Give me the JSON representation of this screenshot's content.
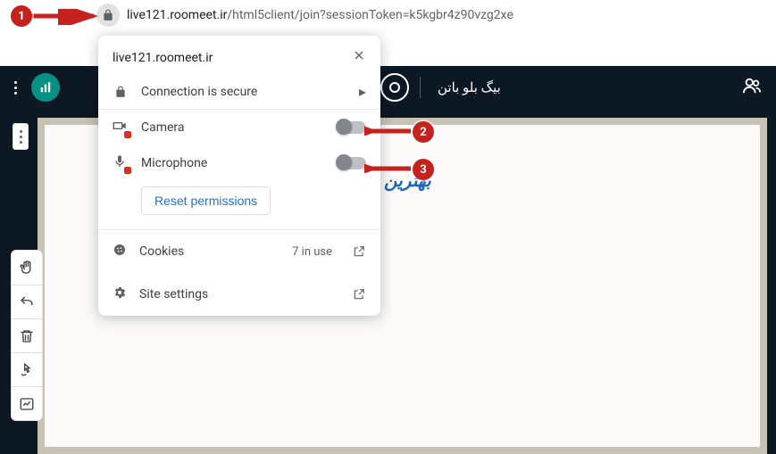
{
  "address_bar": {
    "url_host": "live121.roomeet.ir",
    "url_path": "/html5client/join?sessionToken=k5kgbr4z90vzg2xe"
  },
  "app_header": {
    "room_name": "بیگ بلو باتن"
  },
  "whiteboard": {
    "signature": "بهترین"
  },
  "perm_dropdown": {
    "domain": "live121.roomeet.ir",
    "secure_label": "Connection is secure",
    "camera_label": "Camera",
    "microphone_label": "Microphone",
    "reset_label": "Reset permissions",
    "cookies_label": "Cookies",
    "cookies_count": "7 in use",
    "site_settings_label": "Site settings"
  },
  "annotations": {
    "badge1": "1",
    "badge2": "2",
    "badge3": "3"
  }
}
